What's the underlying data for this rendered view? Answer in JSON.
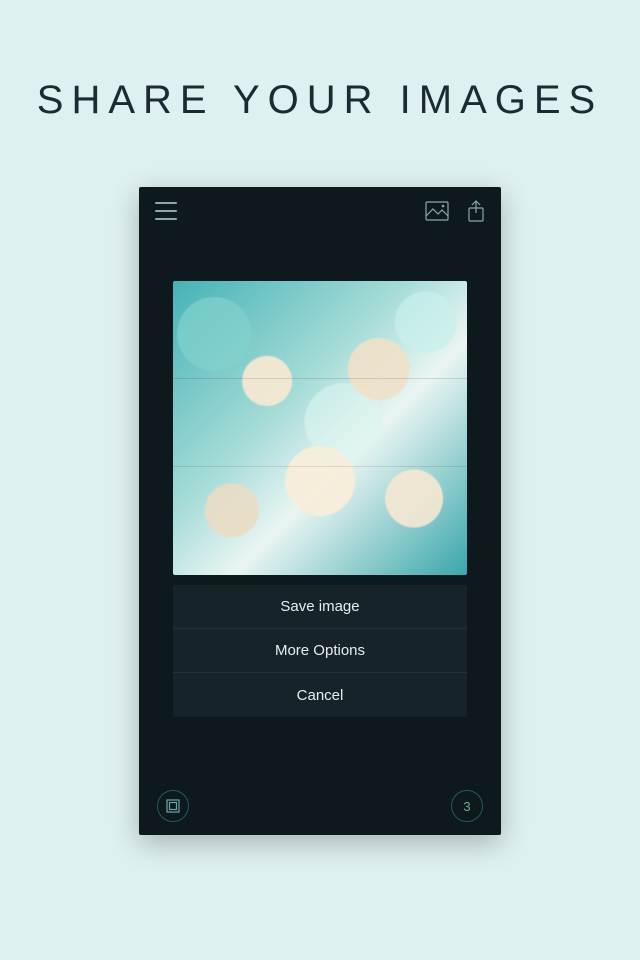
{
  "page": {
    "title": "SHARE YOUR IMAGES"
  },
  "topbar": {
    "menu_icon": "hamburger-icon",
    "gallery_icon": "image-icon",
    "share_icon": "share-icon"
  },
  "sheet": {
    "save_label": "Save image",
    "more_label": "More Options",
    "cancel_label": "Cancel"
  },
  "bottombar": {
    "aspect_icon": "square-icon",
    "count": "3"
  }
}
